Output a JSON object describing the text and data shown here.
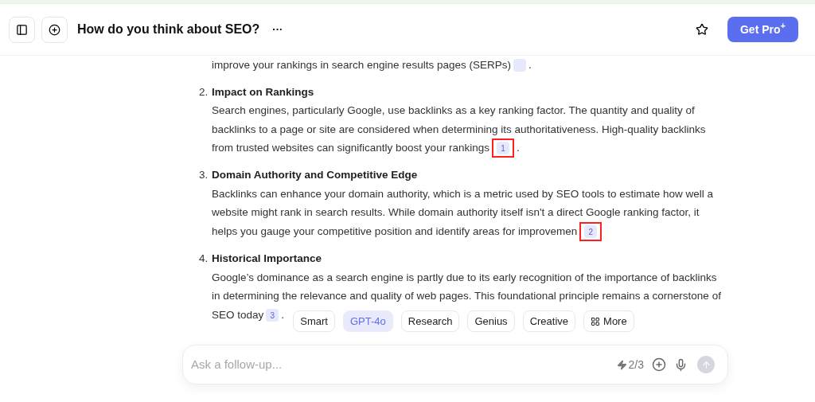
{
  "header": {
    "title": "How do you think about SEO?",
    "more": "···",
    "upgrade": "Get Pro",
    "upgrade_mark": "+"
  },
  "intro": {
    "text": "improve your rankings in search engine results pages (SERPs)",
    "tail": "."
  },
  "items": [
    {
      "number": "2.",
      "title": "Impact on Rankings",
      "body": "Search engines, particularly Google, use backlinks as a key ranking factor. The quantity and quality of backlinks to a page or site are considered when determining its authoritativeness. High-quality backlinks from trusted websites can significantly boost your rankings",
      "citation": "1",
      "highlighted": true,
      "tail": "."
    },
    {
      "number": "3.",
      "title": "Domain Authority and Competitive Edge",
      "body": "Backlinks can enhance your domain authority, which is a metric used by SEO tools to estimate how well a website might rank in search results. While domain authority itself isn't a direct Google ranking factor, it helps you gauge your competitive position and identify areas for improvemen",
      "citation": "2",
      "highlighted": true
    },
    {
      "number": "4.",
      "title": "Historical Importance",
      "body": "Google’s dominance as a search engine is partly due to its early recognition of the importance of backlinks in determining the relevance and quality of web pages. This foundational principle remains a cornerstone of SEO today",
      "citation": "3",
      "highlighted": false,
      "tail": "."
    }
  ],
  "models": [
    {
      "label": "Smart",
      "selected": false,
      "kind": "text"
    },
    {
      "label": "GPT-4o",
      "selected": true,
      "kind": "text"
    },
    {
      "label": "Research",
      "selected": false,
      "kind": "text"
    },
    {
      "label": "Genius",
      "selected": false,
      "kind": "text"
    },
    {
      "label": "Creative",
      "selected": false,
      "kind": "text"
    },
    {
      "label": "More",
      "selected": false,
      "kind": "grid"
    }
  ],
  "composer": {
    "placeholder": "Ask a follow-up...",
    "quota": "2/3"
  }
}
